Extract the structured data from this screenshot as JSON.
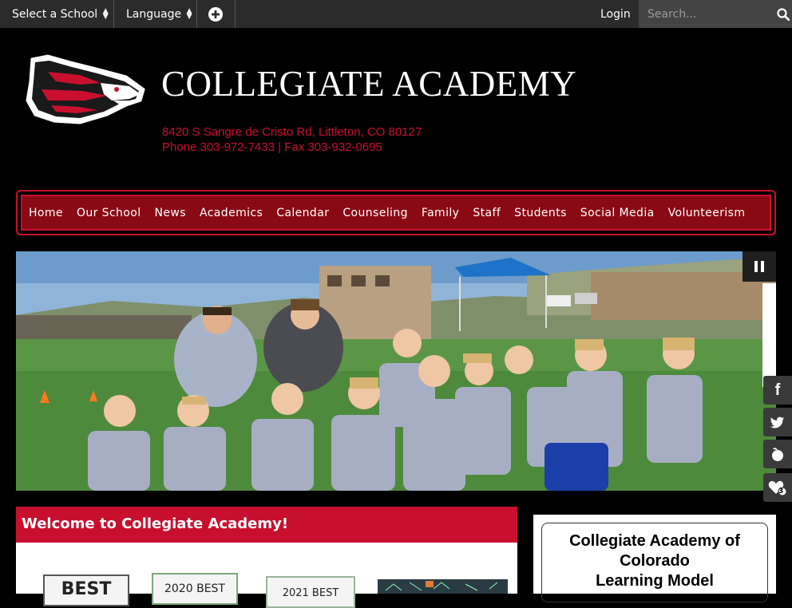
{
  "topbar": {
    "select_school": "Select a School",
    "language": "Language",
    "login": "Login",
    "search_placeholder": "Search..."
  },
  "header": {
    "title": "COLLEGIATE ACADEMY",
    "address": "8420 S Sangre de Cristo Rd, Littleton, CO 80127",
    "phone_fax": "Phone 303-972-7433 | Fax 303-932-0695"
  },
  "nav": {
    "items": [
      "Home",
      "Our School",
      "News",
      "Academics",
      "Calendar",
      "Counseling",
      "Family",
      "Staff",
      "Students",
      "Social Media",
      "Volunteerism"
    ]
  },
  "social": {
    "icons": [
      "facebook-icon",
      "twitter-icon",
      "peachjar-icon",
      "heart-icon"
    ],
    "heart_count": "3"
  },
  "welcome": {
    "title": "Welcome to Collegiate Academy!",
    "awards": [
      "BEST",
      "2020 BEST",
      "2021 BEST"
    ]
  },
  "sidecard": {
    "line1": "Collegiate Academy of",
    "line2": "Colorado",
    "line3": "Learning Model"
  },
  "colors": {
    "brand_red": "#c8102e",
    "nav_bg": "#8a0a14",
    "topbar_bg": "#2b2b2b"
  }
}
